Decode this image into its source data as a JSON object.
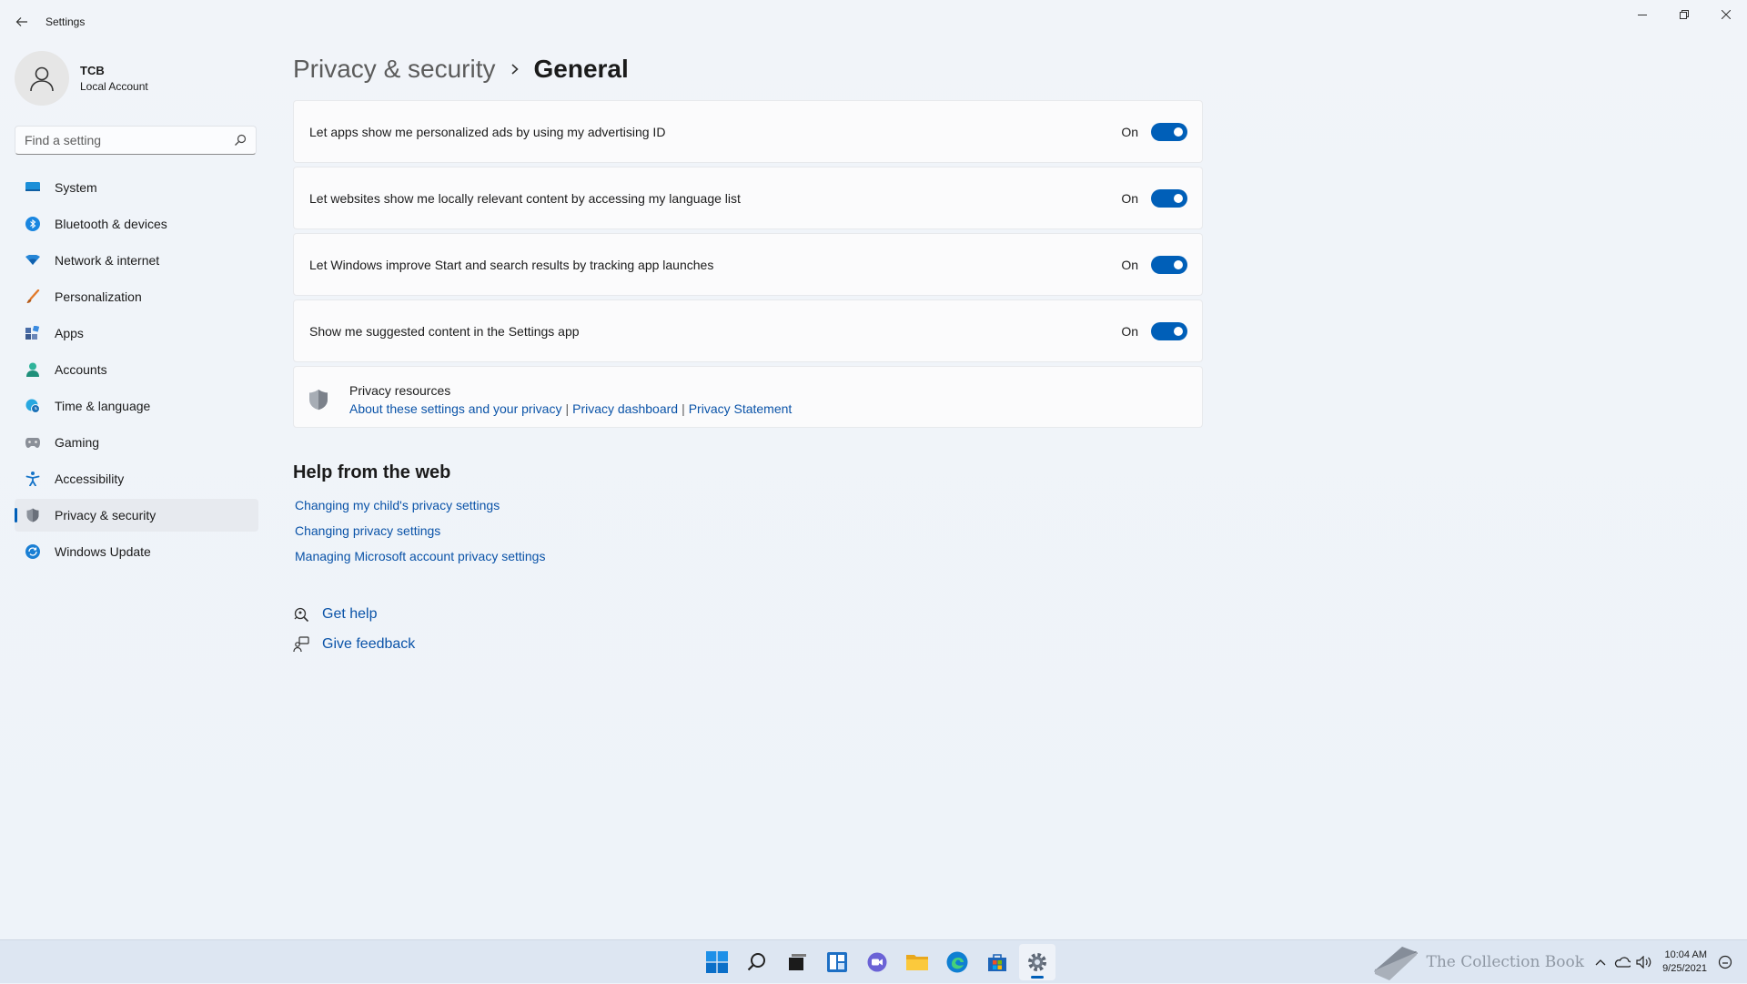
{
  "window": {
    "title": "Settings"
  },
  "profile": {
    "name": "TCB",
    "account_type": "Local Account"
  },
  "search": {
    "placeholder": "Find a setting"
  },
  "nav": {
    "items": [
      {
        "label": "System",
        "icon": "monitor-icon"
      },
      {
        "label": "Bluetooth & devices",
        "icon": "bluetooth-icon"
      },
      {
        "label": "Network & internet",
        "icon": "wifi-icon"
      },
      {
        "label": "Personalization",
        "icon": "brush-icon"
      },
      {
        "label": "Apps",
        "icon": "apps-icon"
      },
      {
        "label": "Accounts",
        "icon": "person-icon"
      },
      {
        "label": "Time & language",
        "icon": "globe-clock-icon"
      },
      {
        "label": "Gaming",
        "icon": "gamepad-icon"
      },
      {
        "label": "Accessibility",
        "icon": "accessibility-icon"
      },
      {
        "label": "Privacy & security",
        "icon": "shield-icon",
        "selected": true
      },
      {
        "label": "Windows Update",
        "icon": "update-icon"
      }
    ]
  },
  "breadcrumb": {
    "parent": "Privacy & security",
    "current": "General"
  },
  "settings": [
    {
      "label": "Let apps show me personalized ads by using my advertising ID",
      "state": "On",
      "enabled": true
    },
    {
      "label": "Let websites show me locally relevant content by accessing my language list",
      "state": "On",
      "enabled": true
    },
    {
      "label": "Let Windows improve Start and search results by tracking app launches",
      "state": "On",
      "enabled": true
    },
    {
      "label": "Show me suggested content in the Settings app",
      "state": "On",
      "enabled": true
    }
  ],
  "privacy_resources": {
    "title": "Privacy resources",
    "links": [
      "About these settings and your privacy",
      "Privacy dashboard",
      "Privacy Statement"
    ],
    "separator": "|"
  },
  "help": {
    "title": "Help from the web",
    "links": [
      "Changing my child's privacy settings",
      "Changing privacy settings",
      "Managing Microsoft account privacy settings"
    ]
  },
  "support": {
    "get_help": "Get help",
    "give_feedback": "Give feedback"
  },
  "taskbar": {
    "apps": [
      "start-icon",
      "search-icon",
      "task-view-icon",
      "widgets-icon",
      "chat-icon",
      "file-explorer-icon",
      "edge-icon",
      "store-icon",
      "settings-icon"
    ],
    "active": "settings-icon",
    "watermark": "The Collection Book",
    "time": "10:04 AM",
    "date": "9/25/2021"
  },
  "colors": {
    "accent": "#005fb8",
    "link": "#0a53a8"
  }
}
